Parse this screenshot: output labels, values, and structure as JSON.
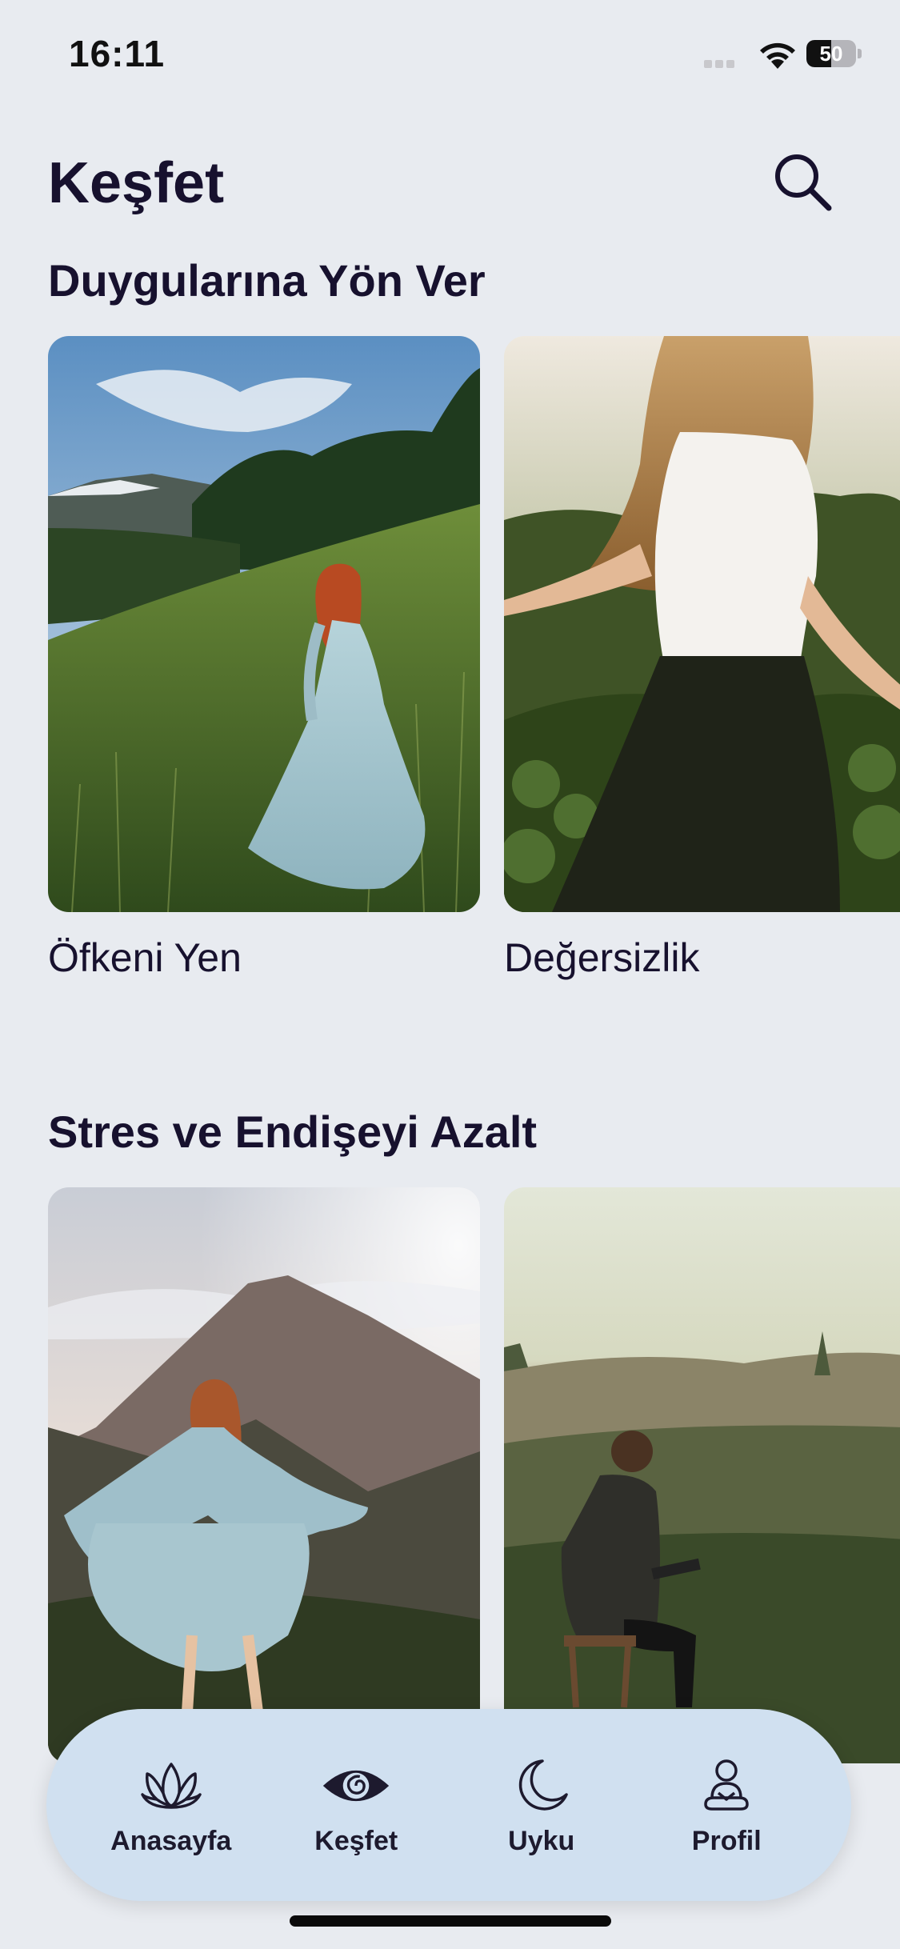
{
  "status_bar": {
    "time": "16:11",
    "battery_level": "50",
    "battery_fraction": 0.5
  },
  "header": {
    "title": "Keşfet",
    "search_icon": "search-icon"
  },
  "sections": [
    {
      "title": "Duygularına Yön Ver",
      "cards": [
        {
          "label": "Öfkeni Yen",
          "image": "woman-in-blue-dress-on-hillside"
        },
        {
          "label": "Değersizlik",
          "image": "woman-with-flowing-hair-in-field"
        }
      ]
    },
    {
      "title": "Stres ve Endişeyi Azalt",
      "cards": [
        {
          "label": "",
          "image": "woman-twirling-dress-at-sunset-mountain"
        },
        {
          "label": "",
          "image": "man-reading-on-stool-in-meadow"
        }
      ]
    }
  ],
  "tab_bar": {
    "items": [
      {
        "label": "Anasayfa",
        "icon": "lotus-icon"
      },
      {
        "label": "Keşfet",
        "icon": "eye-icon",
        "active": true
      },
      {
        "label": "Uyku",
        "icon": "moon-icon"
      },
      {
        "label": "Profil",
        "icon": "meditation-person-icon"
      }
    ]
  },
  "colors": {
    "background": "#e8ebf0",
    "title_text": "#17112e",
    "tab_bar_bg": "#d0e0f0"
  }
}
